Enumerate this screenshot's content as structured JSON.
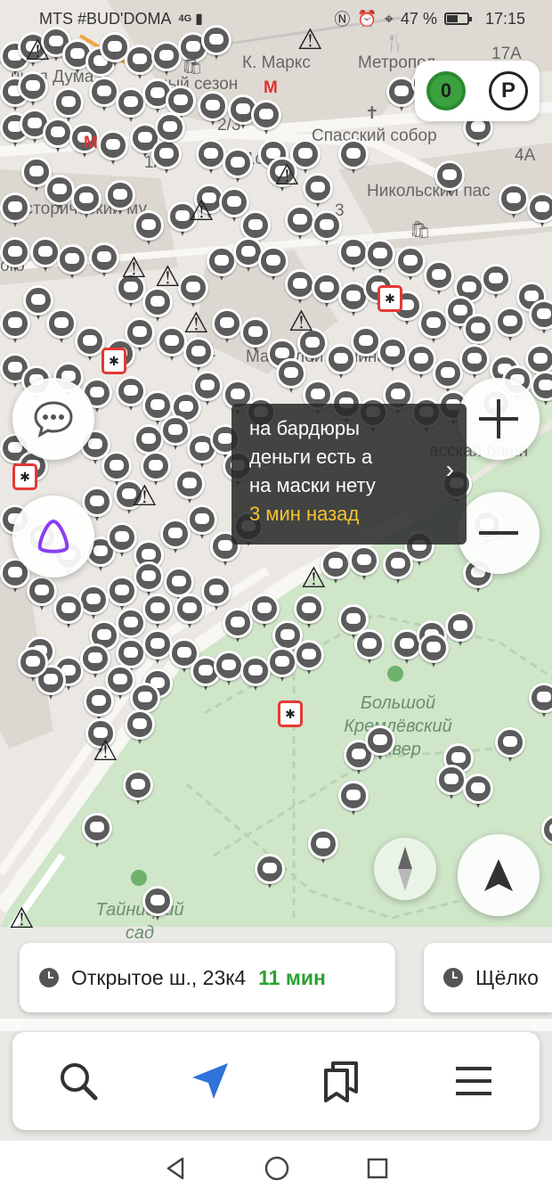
{
  "status_bar": {
    "carrier": "MTS #BUD'DOMA",
    "network": "4G",
    "battery_percent": "47 %",
    "time": "17:15"
  },
  "map": {
    "labels": {
      "k_marks": "К. Маркс",
      "metropol": "Метропол",
      "duma": "нная Дума",
      "season": "ный сезон",
      "spassky": "Спасский собор",
      "nikolsky": "Никольский пас",
      "historical": "Исторический му",
      "lenin": "Мавзолей Ленина",
      "tower": "асская башн",
      "big_square_1": "Большой",
      "big_square_2": "Кремлёвский",
      "big_square_3": "сквер",
      "secret_1": "Тайницкий",
      "secret_2": "сад",
      "house_1a": "1А",
      "house_2_3": "2/3",
      "house_5_1": "5/1с2",
      "house_3": "3",
      "house_4a": "4А",
      "house_17a": "17А",
      "house_1": "1",
      "house_8": "8",
      "house_13": "13",
      "ogo": "ого"
    },
    "traffic_score": "0",
    "parking_label": "P",
    "tooltip": {
      "text_line1": "на бардюры",
      "text_line2": "деньги есть а",
      "text_line3": "на маски нету",
      "time": "3 мин назад"
    }
  },
  "routes": [
    {
      "address": "Открытое ш., 23к4",
      "eta": "11 мин"
    },
    {
      "address": "Щёлко",
      "eta": ""
    }
  ],
  "icons": {
    "chat": "chat-icon",
    "alice": "alice-icon",
    "zoom_in": "plus-icon",
    "zoom_out": "minus-icon",
    "compass": "compass-icon",
    "location": "navigation-arrow-icon",
    "search": "search-icon",
    "route": "route-arrow-icon",
    "bookmarks": "bookmarks-icon",
    "menu": "menu-icon"
  },
  "colors": {
    "traffic_green": "#3aa13e",
    "eta_green": "#2aa12e",
    "tooltip_time": "#f4c430",
    "accident_red": "#e53935",
    "nav_blue": "#2f73d9",
    "alice_purple": "#8a3ff0"
  }
}
